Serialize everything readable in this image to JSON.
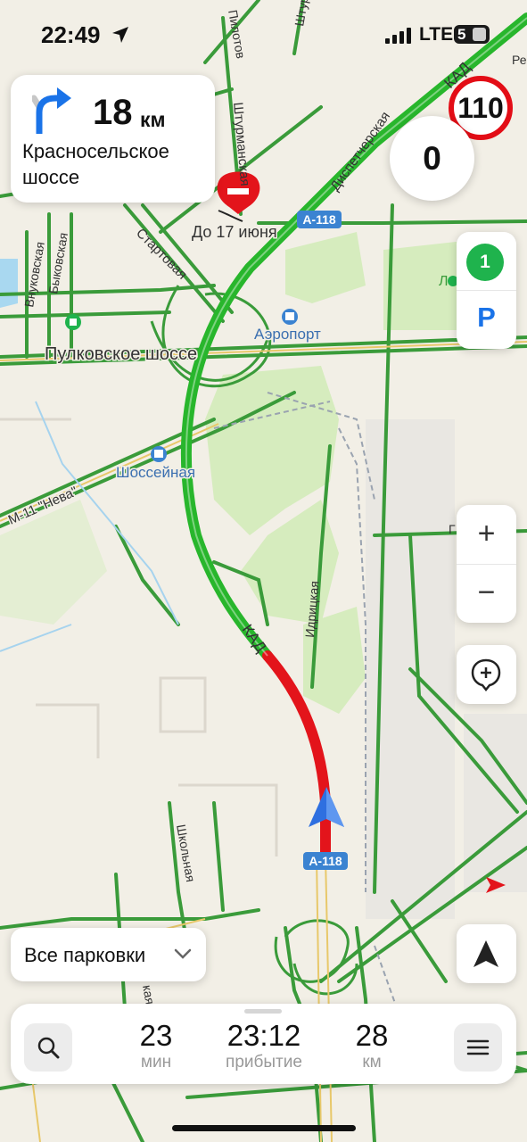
{
  "status_bar": {
    "time": "22:49",
    "network": "LTE",
    "battery_level": "5",
    "location_icon": "location-arrow-icon",
    "signal_icon": "signal-bars-icon"
  },
  "maneuver": {
    "distance": "18",
    "distance_unit": "км",
    "street": "Красносельское шоссе",
    "icon": "turn-right-icon"
  },
  "speed_limit": "110",
  "current_speed": "0",
  "side_panel": {
    "count_badge": "1",
    "parking_label": "P"
  },
  "map": {
    "labels": {
      "road_closure": "До 17 июня",
      "route_ref_top": "А-118",
      "route_ref_bottom": "А-118",
      "kad_top": "КАД",
      "kad_mid": "КАД",
      "pulkovskoe": "Пулковское шоссе",
      "airport": "Аэропорт",
      "shosseynaya": "Шоссейная",
      "m11": "М-11 \"Нева\"",
      "dispetcherskaya": "Диспетчерская",
      "startovaya": "Стартовая",
      "shturmanskaya": "Штурманская",
      "vnukovskaya": "Внуковская",
      "bykovskaya": "Быковская",
      "idritskaya": "Идрицкая",
      "shkolnaya": "Школьная",
      "pilotov": "Пилотов",
      "shtur2": "Штур",
      "le": "Ле",
      "re": "Ре",
      "kaya": "кая",
      "gr": "Г"
    }
  },
  "controls": {
    "zoom_in": "+",
    "zoom_out": "−"
  },
  "parking_selector": {
    "label": "Все парковки"
  },
  "trip": {
    "duration_value": "23",
    "duration_unit": "мин",
    "arrival_value": "23:12",
    "arrival_label": "прибытие",
    "distance_value": "28",
    "distance_unit": "км"
  },
  "colors": {
    "route_green": "#28b62c",
    "route_red": "#e3141b",
    "road_green": "#3a9b3a",
    "park_green": "#d6ecbe",
    "map_bg": "#f2efe6",
    "accent_blue": "#1a73e8",
    "limit_red": "#e30d16"
  }
}
